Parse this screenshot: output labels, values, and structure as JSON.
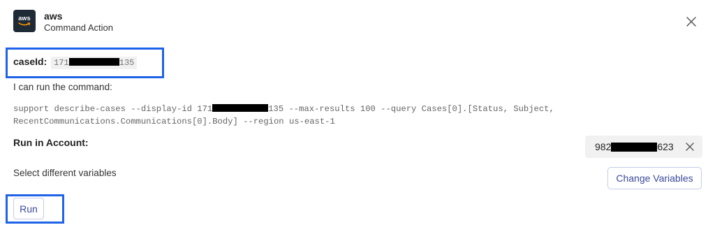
{
  "header": {
    "logo_text": "aws",
    "app_name": "aws",
    "subtitle": "Command Action",
    "close_icon": "close-icon"
  },
  "case": {
    "label": "caseId:",
    "value_prefix": "171",
    "value_suffix": "135"
  },
  "intro_text": "I can run the command:",
  "command": {
    "line1_prefix": "support describe-cases --display-id 171",
    "line1_suffix": "135 --max-results 100 --query Cases[0].[Status, Subject,",
    "line2": "RecentCommunications.Communications[0].Body] --region us-east-1"
  },
  "account": {
    "label": "Run in Account:",
    "value_prefix": "982",
    "value_suffix": "623",
    "clear_icon": "close-icon"
  },
  "variables": {
    "text": "Select different variables",
    "button_label": "Change Variables"
  },
  "run_button_label": "Run",
  "colors": {
    "highlight": "#1f63e8",
    "button_text": "#3a4a9c",
    "button_border": "#c5cbe8",
    "logo_bg": "#1f2a37",
    "logo_accent": "#ff9900"
  }
}
